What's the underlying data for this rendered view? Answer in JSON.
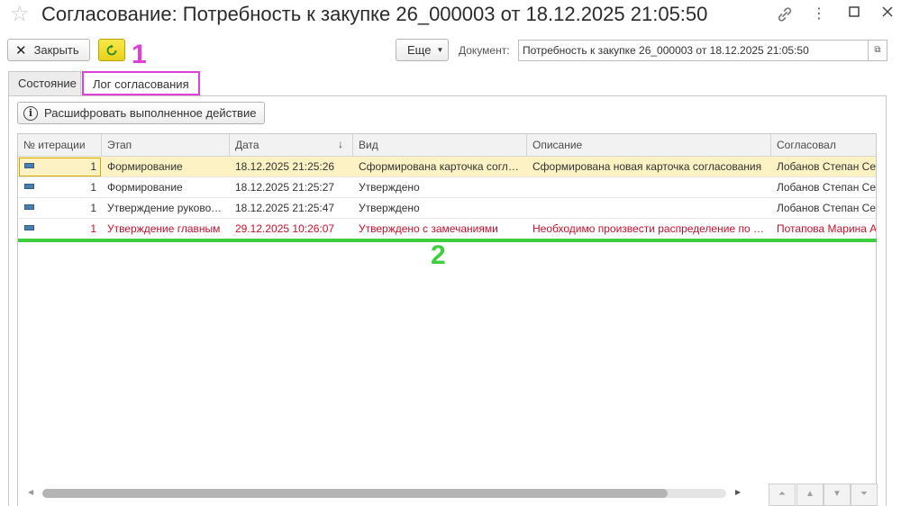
{
  "window": {
    "title": "Согласование: Потребность к закупке 26_000003 от 18.12.2025 21:05:50",
    "icons": [
      "star-icon",
      "link-icon",
      "more-vertical-icon",
      "maximize-icon",
      "close-icon"
    ]
  },
  "toolbar": {
    "close_label": "Закрыть",
    "more_label": "Еще",
    "document_label": "Документ:",
    "document_value": "Потребность к закупке 26_000003 от 18.12.2025 21:05:50"
  },
  "annotations": {
    "first": "1",
    "second": "2"
  },
  "tabs": [
    {
      "label": "Состояние",
      "active": false
    },
    {
      "label": "Лог согласования",
      "active": true
    }
  ],
  "panel": {
    "decode_button": "Расшифровать выполненное действие"
  },
  "table": {
    "columns": [
      "№ итерации",
      "Этап",
      "Дата",
      "Вид",
      "Описание",
      "Согласовал"
    ],
    "sort_indicator": "↓",
    "rows": [
      {
        "iteration": "1",
        "stage": "Формирование",
        "date": "18.12.2025 21:25:26",
        "kind": "Сформирована карточка согласования",
        "description": "Сформирована новая карточка согласования",
        "approver": "Лобанов Степан Сергеевич",
        "selected": true,
        "highlight": false
      },
      {
        "iteration": "1",
        "stage": "Формирование",
        "date": "18.12.2025 21:25:27",
        "kind": "Утверждено",
        "description": "",
        "approver": "Лобанов Степан Сергеевич",
        "selected": false,
        "highlight": false
      },
      {
        "iteration": "1",
        "stage": "Утверждение руководителем",
        "date": "18.12.2025 21:25:47",
        "kind": "Утверждено",
        "description": "",
        "approver": "Лобанов Степан Сергеевич",
        "selected": false,
        "highlight": false
      },
      {
        "iteration": "1",
        "stage": "Утверждение главным",
        "date": "29.12.2025 10:26:07",
        "kind": "Утверждено с замечаниями",
        "description": "Необходимо произвести распределение по статьям",
        "approver": "Потапова Марина Александровна",
        "selected": false,
        "highlight": true
      }
    ]
  },
  "colors": {
    "accent_yellow": "#f2e034",
    "selected_row": "#fcf2c4",
    "highlight_text": "#c8102e",
    "annotation_magenta": "#e040d8",
    "annotation_green": "#3fce3f"
  }
}
